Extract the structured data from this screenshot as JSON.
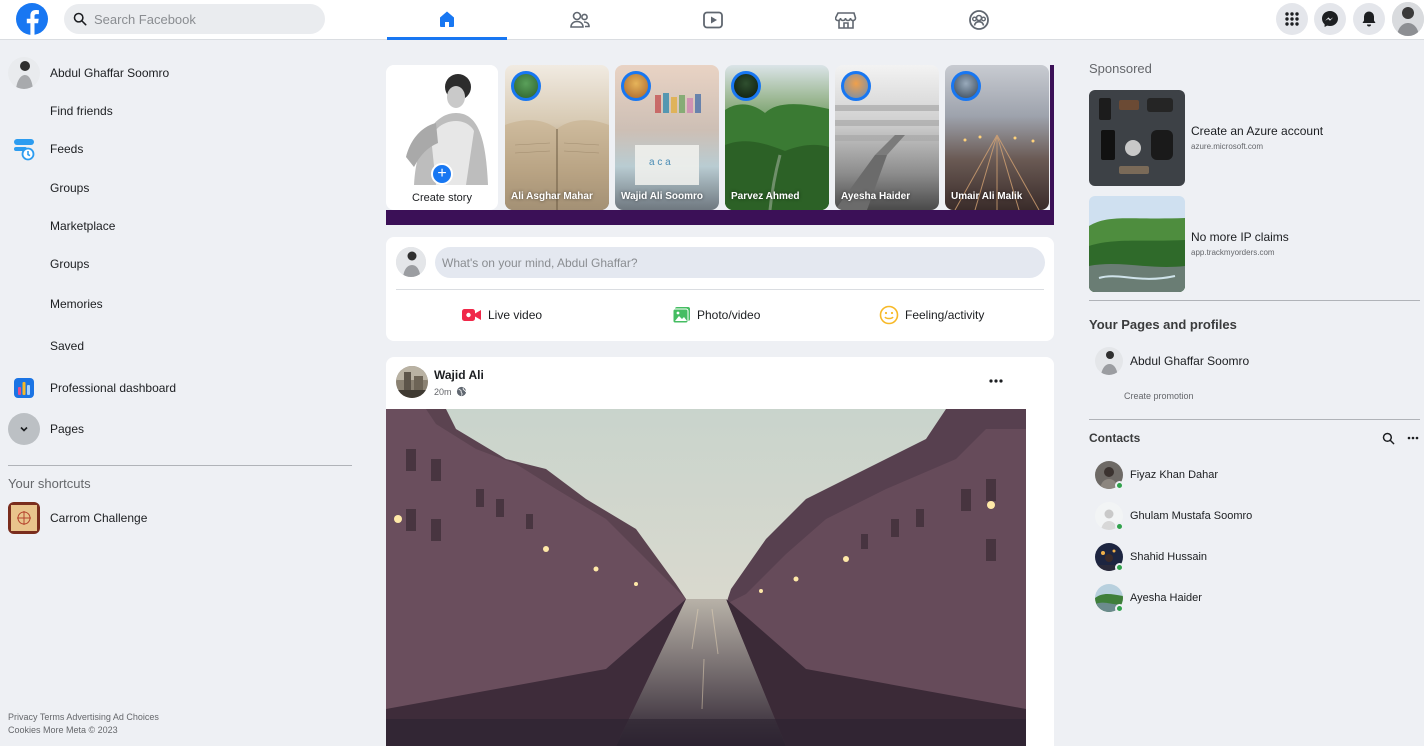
{
  "topbar": {
    "search_placeholder": "Search Facebook",
    "accent_color": "#1877f2",
    "nav_tabs": [
      "home-icon",
      "friends-icon",
      "watch-icon",
      "marketplace-icon",
      "groups-icon"
    ],
    "active_tab": "home-icon",
    "right_buttons": [
      "menu-grid-icon",
      "messenger-icon",
      "notifications-icon"
    ]
  },
  "sidebar": {
    "profile_name": "Abdul Ghaffar Soomro",
    "items": [
      {
        "label": "Find friends"
      },
      {
        "label": "Feeds"
      },
      {
        "label": "Groups"
      },
      {
        "label": "Marketplace"
      },
      {
        "label": "Groups"
      },
      {
        "label": "Memories"
      },
      {
        "label": "Saved"
      },
      {
        "label": "Professional dashboard"
      },
      {
        "label": "Pages"
      }
    ],
    "shortcuts_title": "Your shortcuts",
    "shortcuts": [
      {
        "label": "Carrom Challenge"
      }
    ],
    "footer_line1": "Privacy Terms Advertising Ad Choices",
    "footer_line2": "Cookies More Meta © 2023"
  },
  "stories": {
    "create_label": "Create story",
    "items": [
      {
        "name": "Ali Asghar Mahar"
      },
      {
        "name": "Wajid Ali Soomro"
      },
      {
        "name": "Parvez Ahmed"
      },
      {
        "name": "Ayesha Haider"
      },
      {
        "name": "Umair Ali Malik"
      }
    ]
  },
  "composer": {
    "placeholder": "What's on your mind, Abdul Ghaffar?",
    "live_label": "Live video",
    "photo_label": "Photo/video",
    "feeling_label": "Feeling/activity"
  },
  "post": {
    "author": "Wajid Ali",
    "time": "20m"
  },
  "right": {
    "sponsored_title": "Sponsored",
    "ads": [
      {
        "title": "Create an Azure account",
        "url": "azure.microsoft.com"
      },
      {
        "title": "No more IP claims",
        "url": "app.trackmyorders.com"
      }
    ],
    "pages_title": "Your Pages and profiles",
    "page_name": "Abdul Ghaffar Soomro",
    "create_promotion": "Create promotion",
    "contacts_title": "Contacts",
    "contacts": [
      {
        "name": "Fiyaz Khan Dahar"
      },
      {
        "name": "Ghulam Mustafa Soomro"
      },
      {
        "name": "Shahid Hussain"
      },
      {
        "name": "Ayesha Haider"
      }
    ]
  }
}
